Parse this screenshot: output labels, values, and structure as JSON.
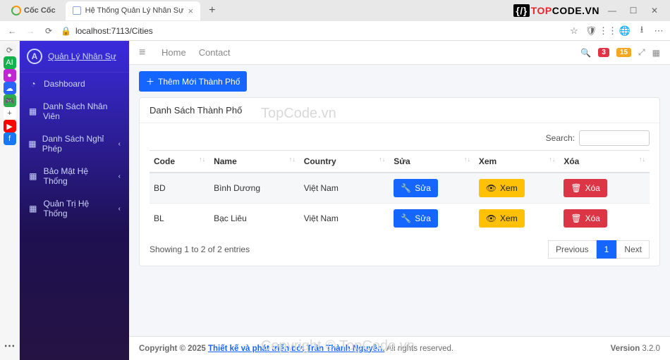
{
  "browser": {
    "logo_text": "Cốc Cốc",
    "tab_title": "Hệ Thống Quản Lý Nhân Sự",
    "url": "localhost:7113/Cities",
    "topcode_brand_bracket": "{/}",
    "topcode_brand_red": "TOP",
    "topcode_brand_black": "CODE.VN",
    "win_min": "—",
    "win_max": "☐",
    "win_close": "✕"
  },
  "leftstrip": {
    "items": [
      {
        "bg": "#f2f2f2",
        "txt": "⟳",
        "fg": "#666"
      },
      {
        "bg": "#14b24c",
        "txt": "AI",
        "fg": "#fff"
      },
      {
        "bg": "#c026d3",
        "txt": "●",
        "fg": "#fff"
      },
      {
        "bg": "#2864ff",
        "txt": "☁",
        "fg": "#fff"
      },
      {
        "bg": "#2cae4f",
        "txt": "🎮",
        "fg": "#fff"
      },
      {
        "bg": "#ffffff",
        "txt": "+",
        "fg": "#555"
      },
      {
        "bg": "#ff0000",
        "txt": "▶",
        "fg": "#fff"
      },
      {
        "bg": "#1877f2",
        "txt": "f",
        "fg": "#fff"
      }
    ]
  },
  "sidebar": {
    "brand": "Quản Lý Nhân Sự",
    "items": [
      {
        "icon": "◔",
        "label": "Dashboard",
        "chev": ""
      },
      {
        "icon": "▦",
        "label": "Danh Sách Nhân Viên",
        "chev": ""
      },
      {
        "icon": "▦",
        "label": "Danh Sách Nghỉ Phép",
        "chev": "‹"
      },
      {
        "icon": "▦",
        "label": "Bảo Mật Hệ Thống",
        "chev": "‹"
      },
      {
        "icon": "▦",
        "label": "Quản Trị Hệ Thống",
        "chev": "‹"
      }
    ]
  },
  "topnav": {
    "home": "Home",
    "contact": "Contact",
    "badge1": "3",
    "badge2": "15"
  },
  "page": {
    "add_btn": "Thêm Mới Thành Phố",
    "card_title": "Danh Sách Thành Phố",
    "search_label": "Search:",
    "columns": [
      "Code",
      "Name",
      "Country",
      "Sửa",
      "Xem",
      "Xóa"
    ],
    "rows": [
      {
        "code": "BD",
        "name": "Bình Dương",
        "country": "Việt Nam"
      },
      {
        "code": "BL",
        "name": "Bạc Liêu",
        "country": "Việt Nam"
      }
    ],
    "btn_edit": "Sửa",
    "btn_view": "Xem",
    "btn_del": "Xóa",
    "info": "Showing 1 to 2 of 2 entries",
    "prev": "Previous",
    "page1": "1",
    "next": "Next"
  },
  "footer": {
    "left1": "Copyright © 2025 ",
    "link": "Thiết kế và phát triển bởi Trần Thành Nguyên.",
    "left2": " All rights reserved.",
    "ver_label": "Version ",
    "ver": "3.2.0"
  },
  "watermark": "TopCode.vn",
  "watermark2": "Copyright © TopCode.vn"
}
